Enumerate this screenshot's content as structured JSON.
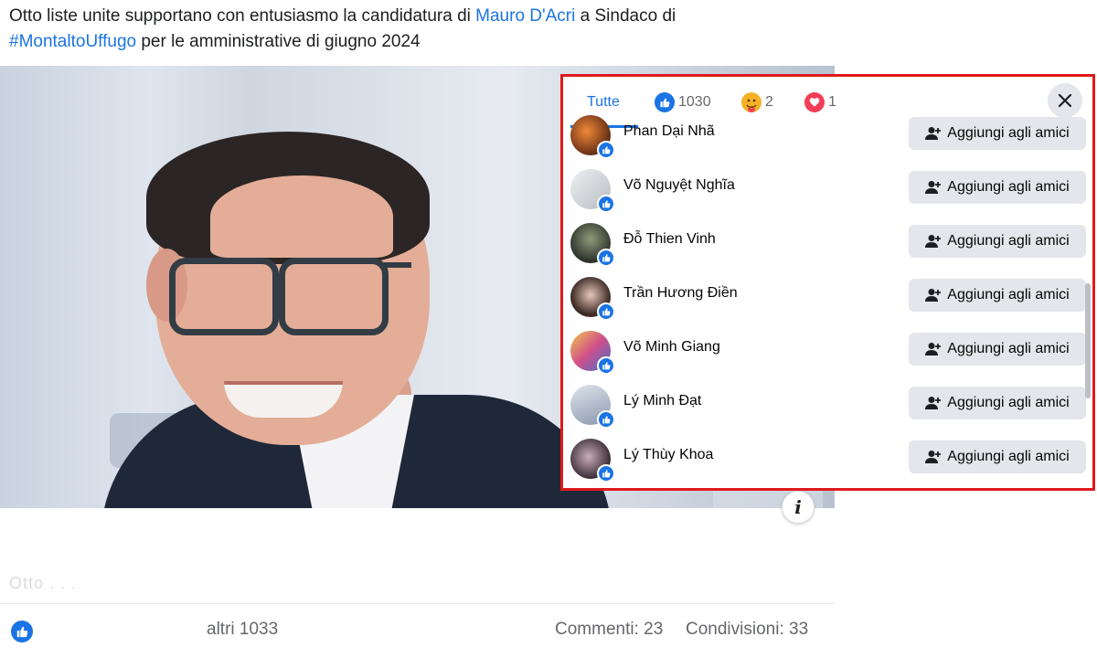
{
  "post": {
    "caption_prefix": "Otto liste unite supportano con entusiasmo la candidatura di ",
    "caption_link": "Mauro D'Acri",
    "caption_middle": " a Sindaco di",
    "caption_hashtag": "#MontaltoUffugo",
    "caption_suffix": " per le amministrative di giugno 2024",
    "faded_text": "Otto . . .",
    "footer": {
      "others": "altri 1033",
      "comments": "Commenti: 23",
      "shares": "Condivisioni: 33"
    }
  },
  "dialog": {
    "tabs": [
      {
        "label": "Tutte",
        "icon": "",
        "active": true
      },
      {
        "label": "1030",
        "icon": "like-icon"
      },
      {
        "label": "2",
        "icon": "care-icon"
      },
      {
        "label": "1",
        "icon": "love-icon"
      }
    ],
    "add_friend_label": "Aggiungi agli amici",
    "people": [
      {
        "name": "Phan Dại Nhã",
        "avatar_color": "#7a3a1a"
      },
      {
        "name": "Võ Nguyệt Nghĩa",
        "avatar_color": "#cfd2d6"
      },
      {
        "name": "Đỗ Thien Vinh",
        "avatar_color": "#3a3f36"
      },
      {
        "name": "Trần Hương Điền",
        "avatar_color": "#3e2b26"
      },
      {
        "name": "Võ Minh Giang",
        "avatar_color": "#c2567a"
      },
      {
        "name": "Lý Minh Đạt",
        "avatar_color": "#a8b5c8"
      },
      {
        "name": "Lý Thùy Khoa",
        "avatar_color": "#5a4a55"
      }
    ]
  },
  "colors": {
    "accent": "#1b74e4",
    "highlight_border": "#e0191c"
  }
}
